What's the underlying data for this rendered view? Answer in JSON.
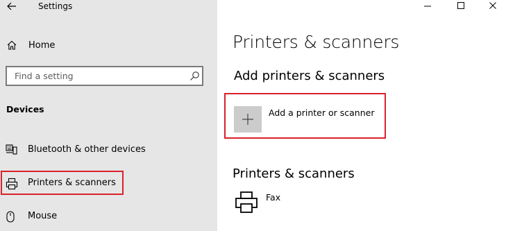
{
  "window": {
    "title": "Settings",
    "controls": {
      "minimize_icon": "minimize-icon",
      "maximize_icon": "maximize-icon",
      "close_icon": "close-icon"
    }
  },
  "sidebar": {
    "back_icon": "back-arrow-icon",
    "home": {
      "label": "Home",
      "icon": "home-icon"
    },
    "search": {
      "placeholder": "Find a setting",
      "icon": "search-icon"
    },
    "section_heading": "Devices",
    "items": [
      {
        "label": "Bluetooth & other devices",
        "icon": "bluetooth-devices-icon"
      },
      {
        "label": "Printers & scanners",
        "icon": "printer-icon",
        "selected": true
      },
      {
        "label": "Mouse",
        "icon": "mouse-icon"
      }
    ]
  },
  "main": {
    "page_title": "Printers & scanners",
    "add_section_heading": "Add printers & scanners",
    "add_button_label": "Add a printer or scanner",
    "list_section_heading": "Printers & scanners",
    "printers": [
      {
        "name": "Fax",
        "icon": "printer-icon"
      }
    ]
  },
  "colors": {
    "sidebar_bg": "#e6e6e6",
    "highlight_box": "#d9222a",
    "add_tile": "#cccccc"
  }
}
